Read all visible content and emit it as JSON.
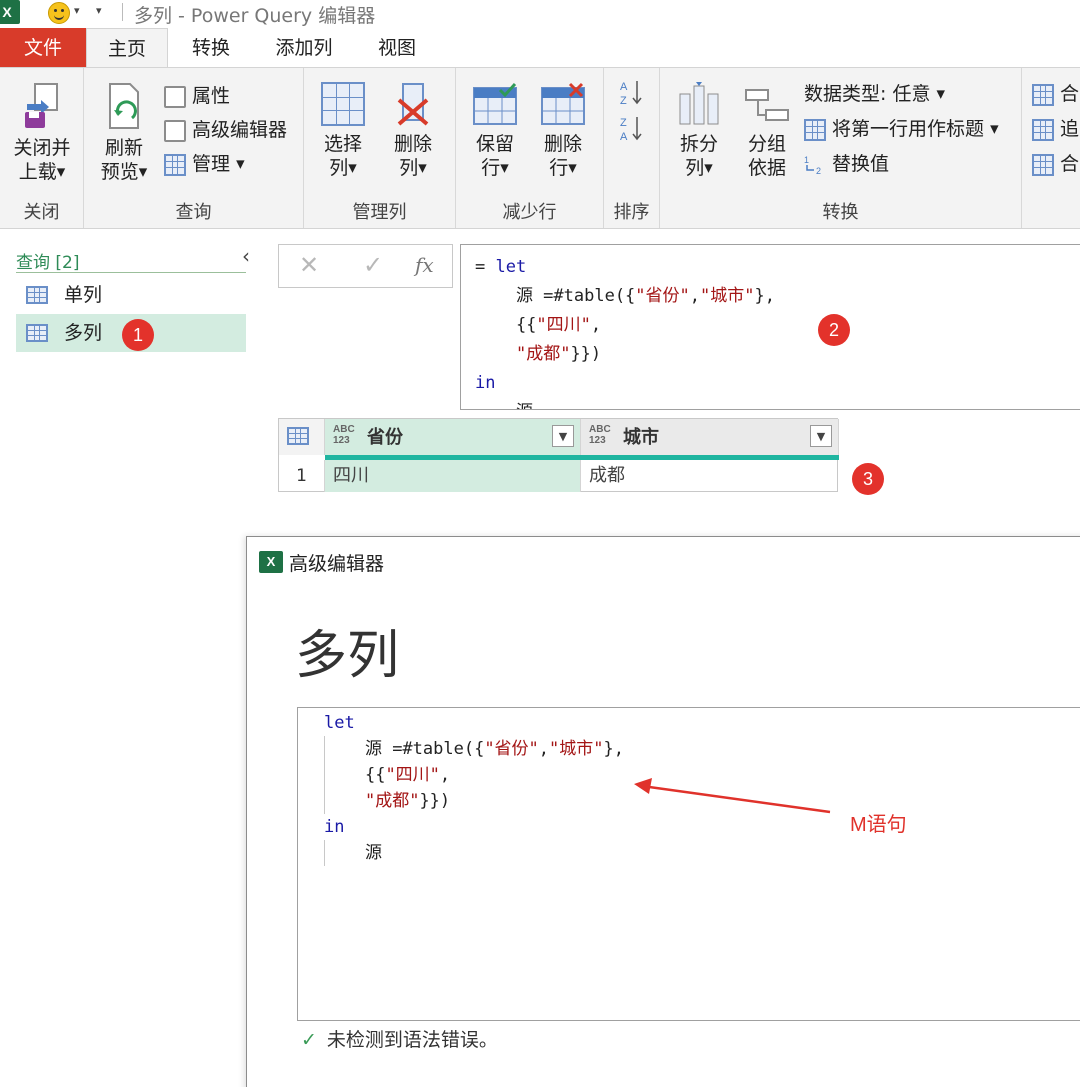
{
  "window": {
    "title": "多列 - Power Query 编辑器",
    "app_logo": "X"
  },
  "ribbon_tabs": [
    "文件",
    "主页",
    "转换",
    "添加列",
    "视图"
  ],
  "ribbon": {
    "close_group": {
      "label": "关闭",
      "close_load": [
        "关闭并",
        "上载"
      ]
    },
    "query_group": {
      "label": "查询",
      "refresh": [
        "刷新",
        "预览"
      ],
      "properties": "属性",
      "advanced_editor": "高级编辑器",
      "manage": "管理"
    },
    "manage_cols_group": {
      "label": "管理列",
      "choose": [
        "选择",
        "列"
      ],
      "remove": [
        "删除",
        "列"
      ]
    },
    "reduce_rows_group": {
      "label": "减少行",
      "keep": [
        "保留",
        "行"
      ],
      "remove": [
        "删除",
        "行"
      ]
    },
    "sort_group": {
      "label": "排序"
    },
    "transform_group": {
      "label": "转换",
      "split": [
        "拆分",
        "列"
      ],
      "group_by": [
        "分组",
        "依据"
      ],
      "data_type": "数据类型: 任意",
      "first_row_header": "将第一行用作标题",
      "replace_values": "替换值"
    },
    "combine_group": {
      "merge": "合",
      "append": "追",
      "combine": "合"
    }
  },
  "queries_pane": {
    "header": "查询 [2]",
    "items": [
      {
        "label": "单列",
        "selected": false
      },
      {
        "label": "多列",
        "selected": true
      }
    ]
  },
  "formula_bar": {
    "buttons": {
      "cancel": "✕",
      "commit": "✓",
      "fx": "fx"
    },
    "lines": [
      "= let",
      "    源 =#table({\"省份\",\"城市\"},",
      "    {{\"四川\",",
      "    \"成都\"}})",
      "in",
      "    源"
    ]
  },
  "data_grid": {
    "columns": [
      {
        "type": "ABC 123",
        "name": "省份"
      },
      {
        "type": "ABC 123",
        "name": "城市"
      }
    ],
    "rows": [
      {
        "index": "1",
        "cells": [
          "四川",
          "成都"
        ]
      }
    ]
  },
  "advanced_editor": {
    "window_title": "高级编辑器",
    "query_name": "多列",
    "code": {
      "let": "let",
      "line1_a": "源 =#table({",
      "line1_s1": "\"省份\"",
      "line1_b": ",",
      "line1_s2": "\"城市\"",
      "line1_c": "},",
      "line2_a": "{{",
      "line2_s": "\"四川\"",
      "line2_b": ",",
      "line3_s": "\"成都\"",
      "line3_b": "}})",
      "in": "in",
      "result": "源"
    },
    "status": "未检测到语法错误。"
  },
  "annotations": {
    "badges": [
      "1",
      "2",
      "3"
    ],
    "arrow_label": "M语句"
  },
  "colors": {
    "file_tab": "#d83b2a",
    "selection_green": "#d3ece0",
    "column_bar": "#1fb5a0",
    "badge_red": "#e3322b",
    "keyword_blue": "#1a1aa6",
    "string_red": "#a31515"
  }
}
